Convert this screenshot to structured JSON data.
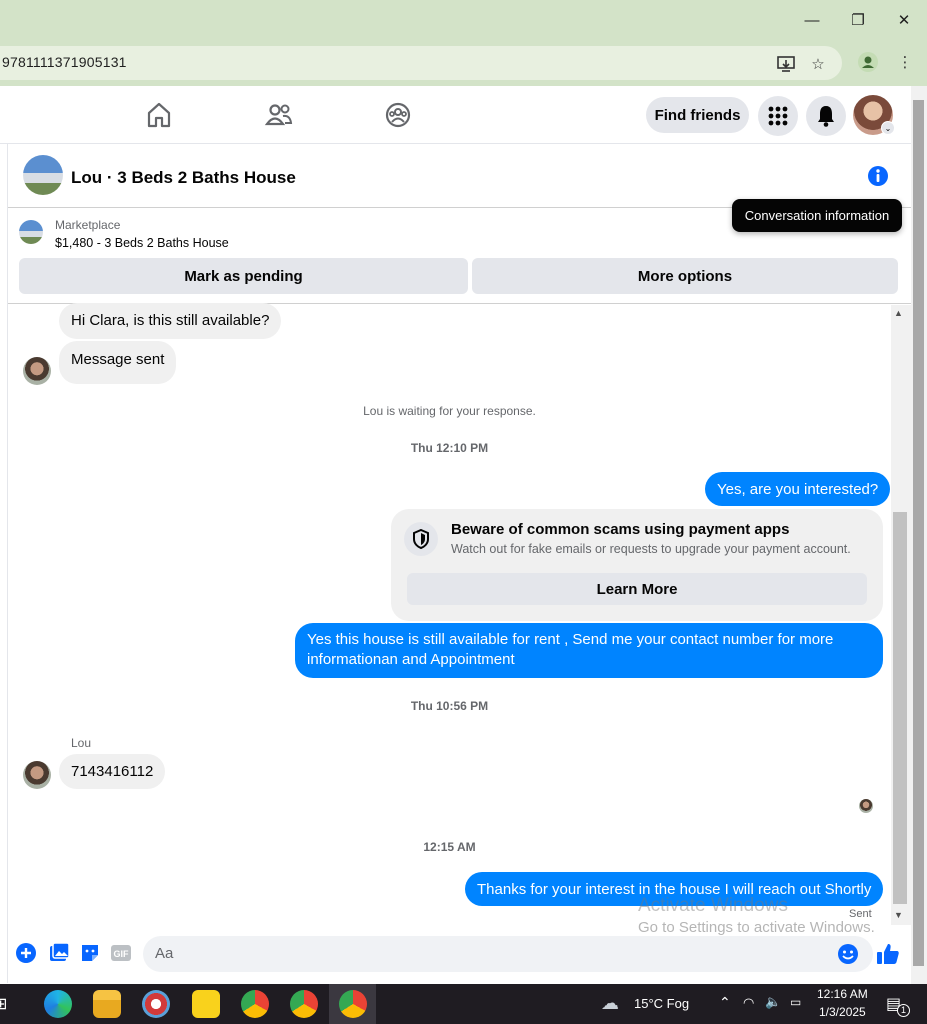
{
  "browser": {
    "url": "9781111371905131",
    "window_controls": {
      "minimize": "—",
      "restore": "❐",
      "close": "✕"
    }
  },
  "header": {
    "find_friends": "Find friends"
  },
  "conversation": {
    "title": "Lou · 3 Beds 2 Baths House",
    "tooltip": "Conversation information",
    "marketplace_label": "Marketplace",
    "listing": "$1,480 - 3 Beds 2 Baths House",
    "mark_pending": "Mark as pending",
    "more_options": "More options"
  },
  "messages": {
    "m1": "Hi Clara, is this still available?",
    "m2": "Message sent",
    "waiting": "Lou is waiting for your response.",
    "t1": "Thu 12:10 PM",
    "m3": "Yes, are you interested?",
    "scam_title": "Beware of common scams using payment apps",
    "scam_sub": "Watch out for fake emails or requests to upgrade your payment account.",
    "learn_more": "Learn More",
    "m4": "Yes this house is still available for rent , Send me your contact number for more informationan and Appointment",
    "t2": "Thu 10:56 PM",
    "sender": "Lou",
    "m5": "7143416112",
    "t3": "12:15 AM",
    "m6": "Thanks for your interest in the house I will reach out Shortly",
    "status": "Sent"
  },
  "composer": {
    "placeholder": "Aa"
  },
  "watermark": {
    "line1": "Activate Windows",
    "line2": "Go to Settings to activate Windows."
  },
  "taskbar": {
    "weather": "15°C  Fog",
    "time": "12:16 AM",
    "date": "1/3/2025",
    "notification_count": "1"
  },
  "colors": {
    "accent": "#0084ff",
    "titlebar": "#d3e3c8",
    "bubble_in": "#f0f0f0"
  }
}
